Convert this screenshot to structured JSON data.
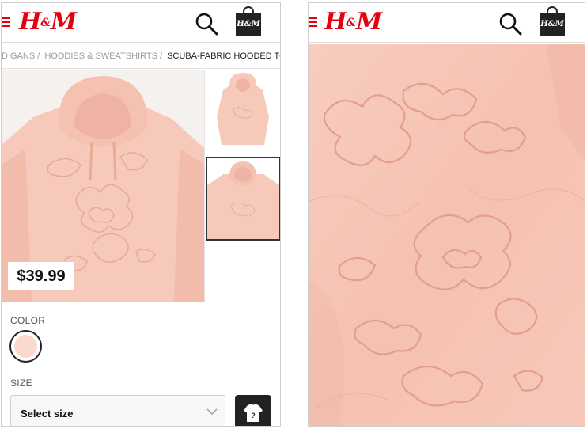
{
  "header": {
    "logo_text": "H",
    "logo_amp": "&",
    "logo_text_end": "M",
    "bag_text": "H&M"
  },
  "breadcrumb": {
    "items": [
      "DIGANS",
      "HOODIES & SWEATSHIRTS"
    ],
    "current": "SCUBA-FABRIC HOODED TOP",
    "separator": "/"
  },
  "product": {
    "price": "$39.99",
    "color_label": "COLOR",
    "size_label": "SIZE",
    "size_select_value": "Select size",
    "swatch_color": "#fbd9cc"
  },
  "colors": {
    "brand_red": "#e50010",
    "product_pink": "#f6c5b6",
    "dark": "#222222"
  },
  "icons": [
    "menu-icon",
    "search-icon",
    "shopping-bag-icon",
    "chevron-down-icon",
    "t-shirt-icon"
  ]
}
